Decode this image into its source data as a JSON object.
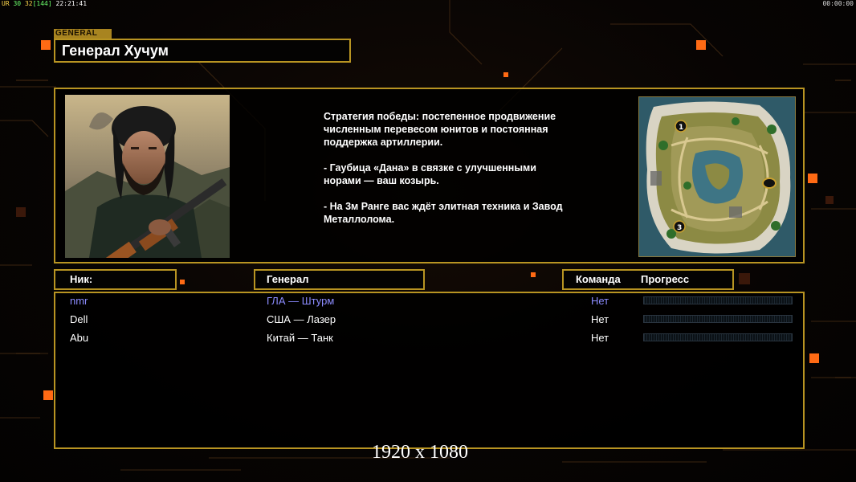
{
  "hud": {
    "left_a": "UR",
    "left_b": "30",
    "left_c": "32",
    "left_d": "[144]",
    "left_time": "22:21:41",
    "right_time": "00:00:00"
  },
  "general_tag": "GENERAL",
  "title": "Генерал Хучум",
  "description": [
    "Стратегия победы: постепенное продвижение численным перевесом юнитов и постоянная поддержка артиллерии.",
    "- Гаубица «Дана» в связке с улучшенными норами — ваш козырь.",
    "- На 3м Ранге вас ждёт элитная техника и Завод Металлолома."
  ],
  "minimap": {
    "markers": [
      "1",
      "3"
    ]
  },
  "table": {
    "headers": {
      "nick": "Ник:",
      "general": "Генерал",
      "team": "Команда",
      "progress": "Прогресс"
    },
    "rows": [
      {
        "nick": "nmr",
        "general": "ГЛА — Штурм",
        "team": "Нет",
        "progress": 0,
        "color": "#8c8cff"
      },
      {
        "nick": "Dell",
        "general": "США — Лазер",
        "team": "Нет",
        "progress": 0,
        "color": "#ffffff"
      },
      {
        "nick": "Abu",
        "general": "Китай — Танк",
        "team": "Нет",
        "progress": 0,
        "color": "#ffffff"
      }
    ]
  },
  "resolution_label": "1920 x 1080",
  "colors": {
    "accent_gold": "#b89422",
    "player_self": "#8c8cff"
  }
}
